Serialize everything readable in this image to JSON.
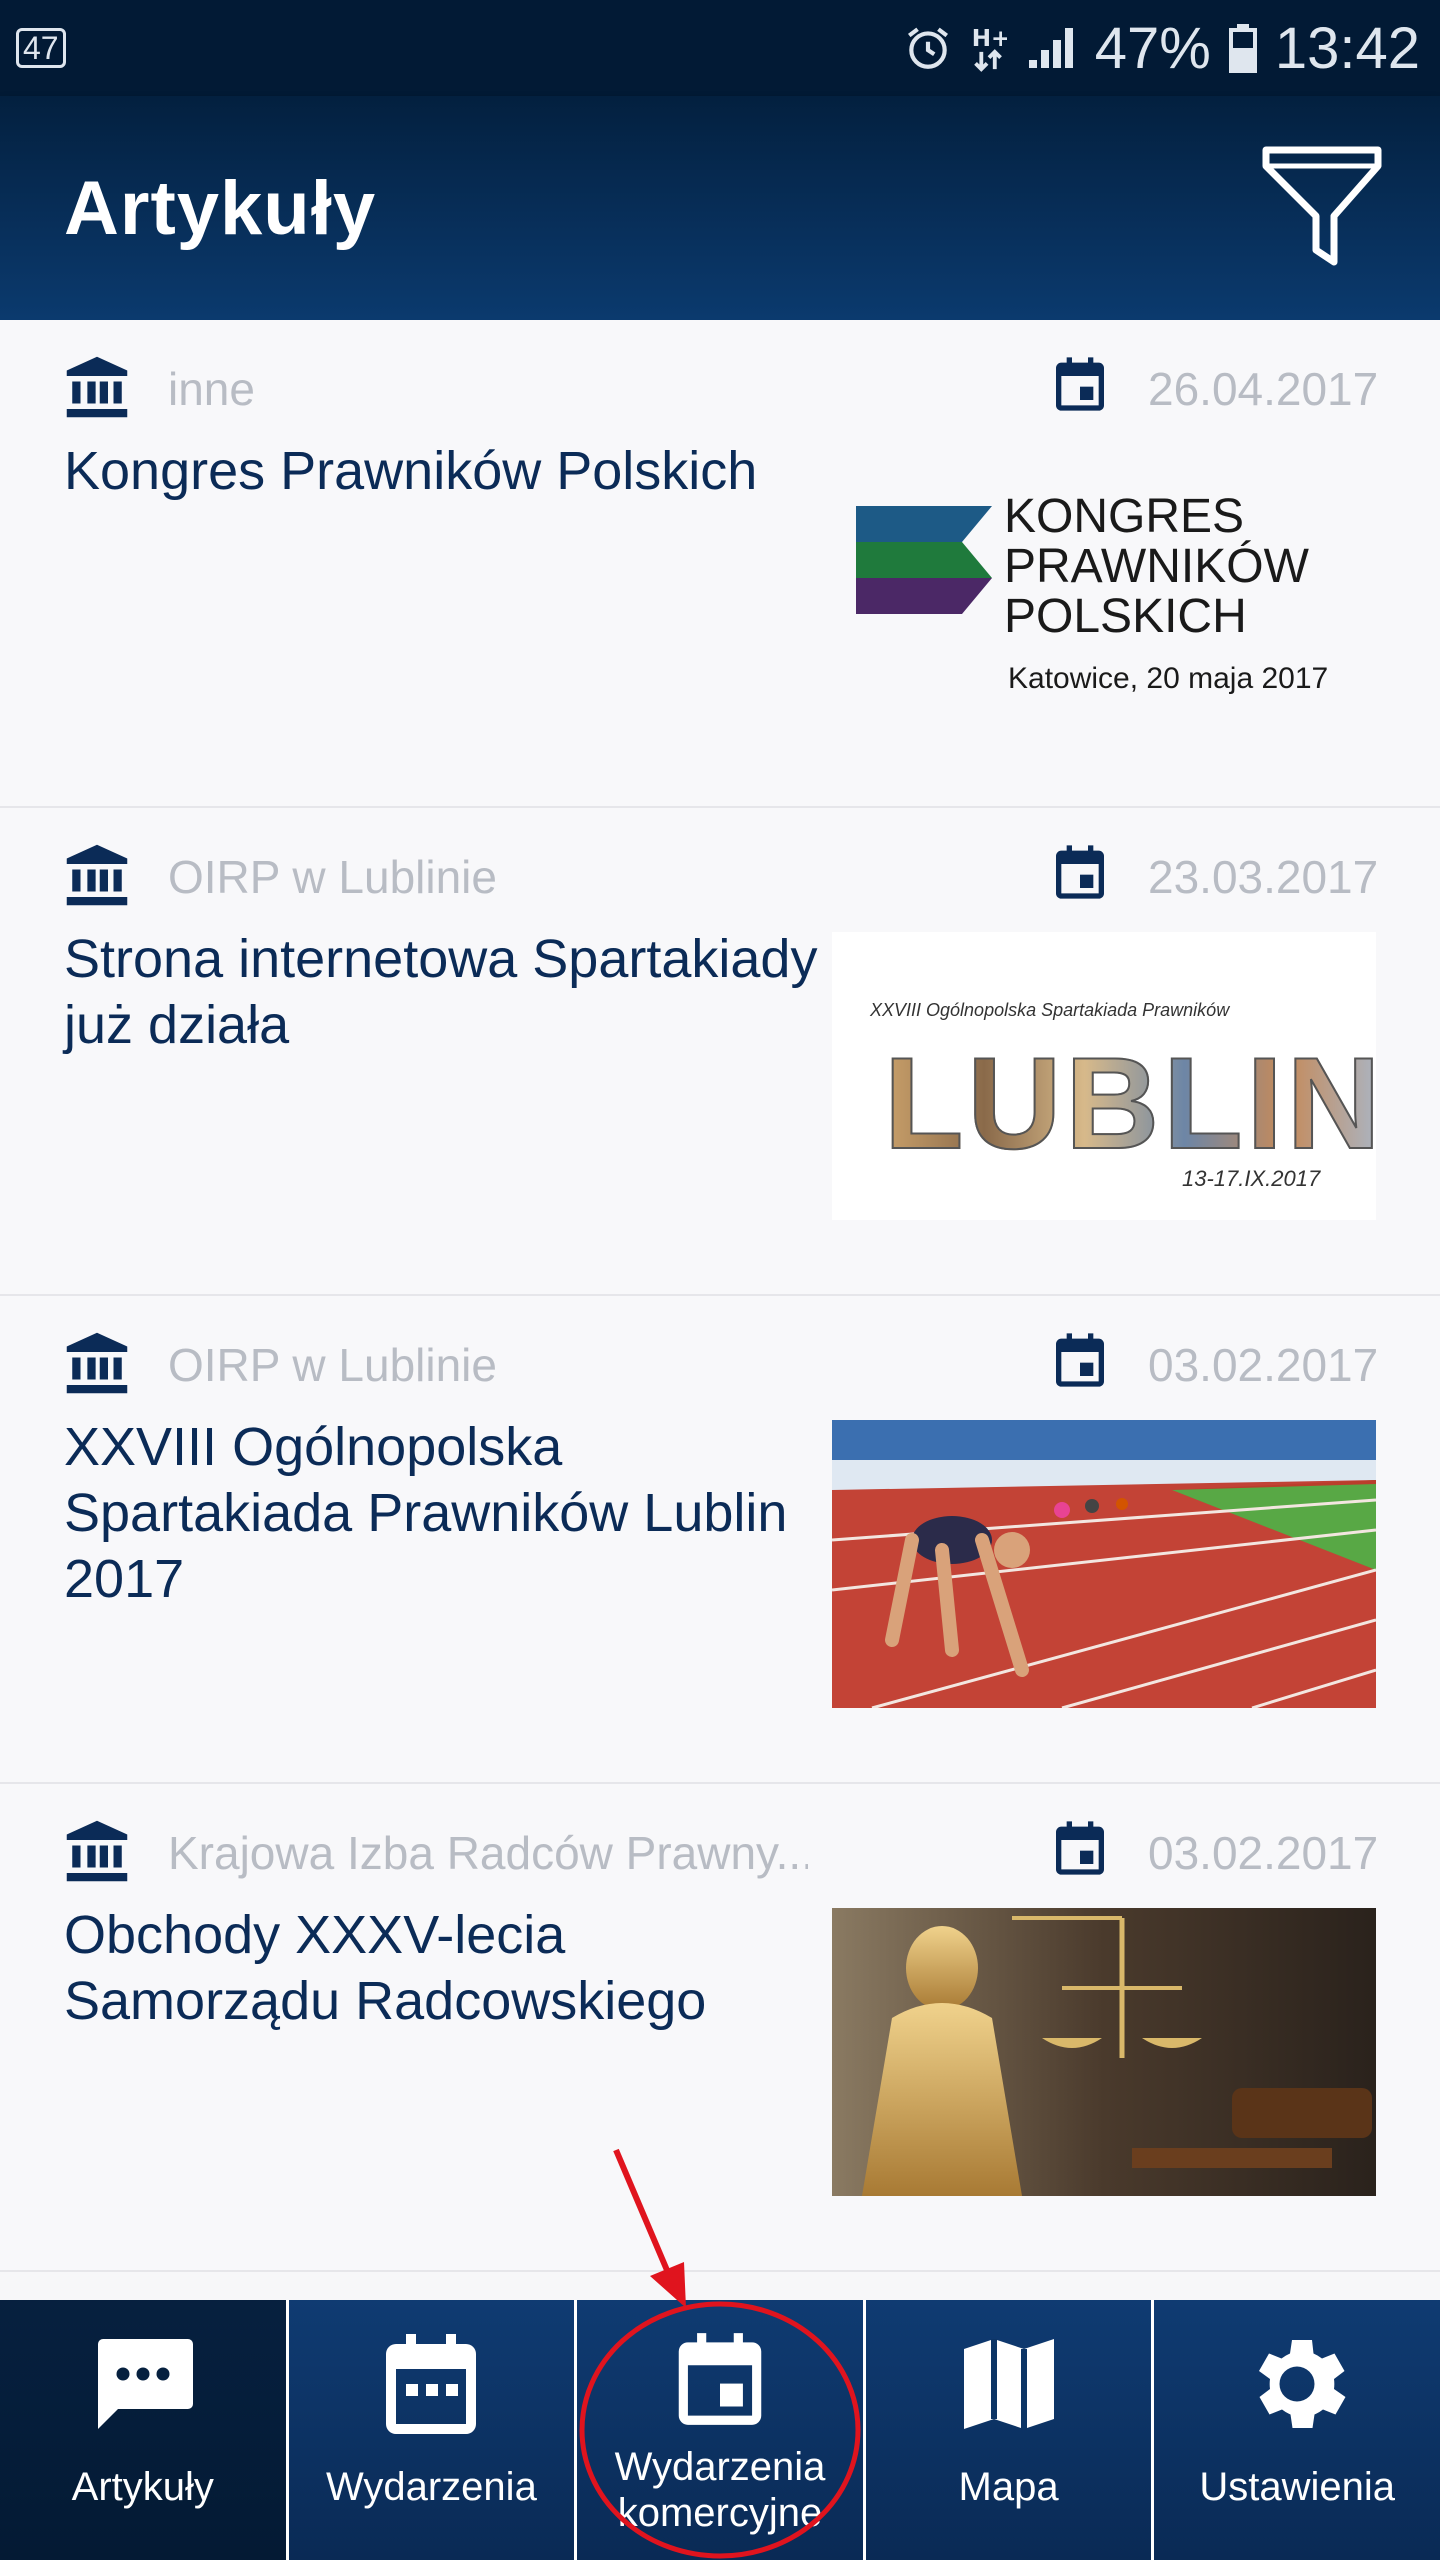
{
  "status_bar": {
    "badge": "47",
    "battery": "47%",
    "time": "13:42",
    "icons": [
      "alarm-icon",
      "hplus-icon",
      "signal-icon",
      "battery-icon"
    ]
  },
  "app_bar": {
    "title": "Artykuły",
    "filter_icon": "filter-icon"
  },
  "articles": [
    {
      "source": "inne",
      "date": "26.04.2017",
      "title": "Kongres Prawników Polskich",
      "logo_lines": [
        "KONGRES",
        "PRAWNIKÓW",
        "POLSKICH"
      ],
      "logo_caption": "Katowice, 20 maja 2017"
    },
    {
      "source": "OIRP w Lublinie",
      "date": "23.03.2017",
      "title": "Strona internetowa Spartakiady już działa",
      "img_header": "XXVIII Ogólnopolska Spartakiada Prawników",
      "img_word": "LUBLIN",
      "img_dates": "13-17.IX.2017"
    },
    {
      "source": "OIRP w Lublinie",
      "date": "03.02.2017",
      "title": "XXVIII Ogólnopolska Spartakiada Prawników Lublin 2017"
    },
    {
      "source": "Krajowa Izba Radców Prawny...",
      "date": "03.02.2017",
      "title": "Obchody XXXV-lecia Samorządu Radcowskiego"
    }
  ],
  "bottom_nav": [
    {
      "label": "Artykuły",
      "icon": "chat-icon"
    },
    {
      "label": "Wydarzenia",
      "icon": "calendar-icon"
    },
    {
      "label": "Wydarzenia komercyjne",
      "icon": "calendar-event-icon"
    },
    {
      "label": "Mapa",
      "icon": "map-icon"
    },
    {
      "label": "Ustawienia",
      "icon": "gear-icon"
    }
  ],
  "colors": {
    "primary_dark": "#03203f",
    "primary": "#0b3a6e",
    "title_text": "#0b2b57",
    "meta_text": "#b8bcc4",
    "annotation": "#e0141e"
  }
}
